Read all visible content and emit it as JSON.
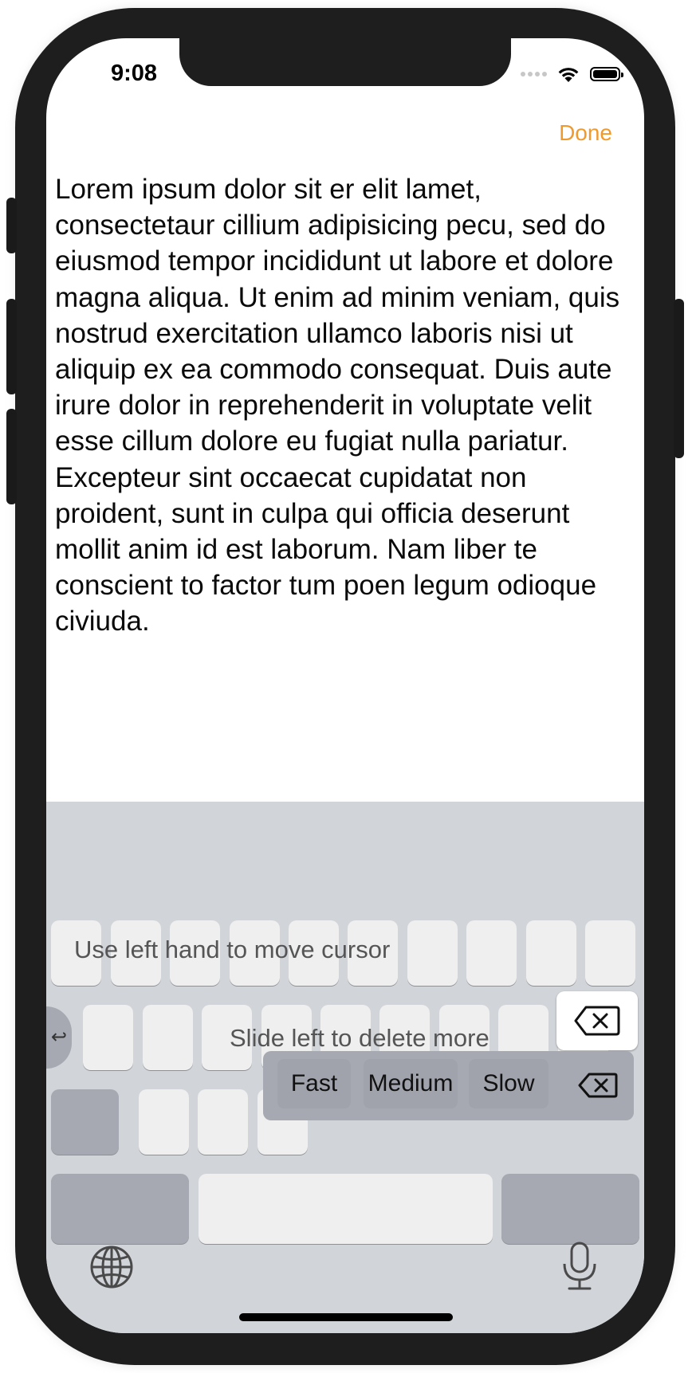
{
  "status_bar": {
    "time": "9:08"
  },
  "nav": {
    "done_label": "Done"
  },
  "document": {
    "text": "Lorem ipsum dolor sit er elit lamet, consectetaur cillium adipisicing pecu, sed do eiusmod tempor incididunt ut labore et dolore magna aliqua. Ut enim ad minim veniam, quis nostrud exercitation ullamco laboris nisi ut aliquip ex ea commodo consequat. Duis aute irure dolor in reprehenderit in voluptate velit esse cillum dolore eu fugiat nulla pariatur. Excepteur sint occaecat cupidatat non proident, sunt in culpa qui officia deserunt mollit anim id est laborum. Nam liber te conscient to factor tum poen legum odioque civiuda."
  },
  "keyboard": {
    "hint_cursor": "Use left hand to move cursor",
    "hint_delete": "Slide left to delete more",
    "speed_options": [
      "Fast",
      "Medium",
      "Slow"
    ],
    "undo_glyph": "↩"
  },
  "colors": {
    "accent": "#f09a2e",
    "keyboard_bg": "#d1d4d9",
    "key_light": "#efefef",
    "key_dark": "#a6a9b1"
  },
  "icons": [
    "signal-icon",
    "wifi-icon",
    "battery-icon",
    "delete-icon",
    "globe-icon",
    "microphone-icon",
    "undo-icon"
  ]
}
